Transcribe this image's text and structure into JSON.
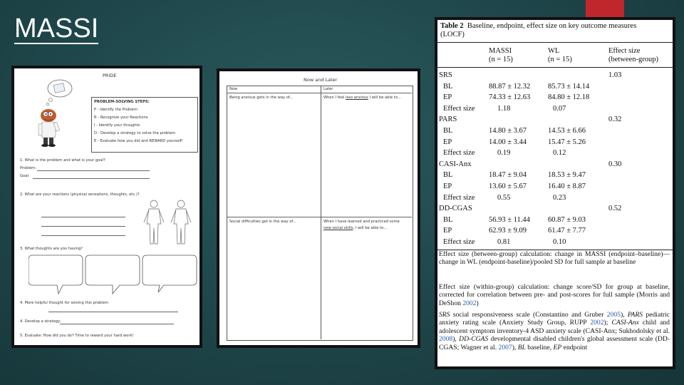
{
  "slide": {
    "title": "MASSI",
    "accent_color": "#c0272d",
    "background_color": "#1e4549"
  },
  "pride_worksheet": {
    "heading": "PRIDE",
    "steps_title": "PROBLEM-SOLVING STEPS:",
    "steps": [
      "P - Identify the Problem",
      "R - Recognize your Reactions",
      "I - Identify your thoughts",
      "D - Develop a strategy to solve the problem",
      "E - Evaluate how you did and REWARD yourself!"
    ],
    "q1": "1. What is the problem and what is your goal?",
    "problem_label": "Problem:",
    "goal_label": "Goal:",
    "q2": "2. What are your reactions (physical sensations, thoughts, etc.)?",
    "q3": "3. What thoughts are you having?",
    "q4": "4. More helpful thought for solving this problem",
    "q5": "4. Develop a strategy:",
    "q6": "5. Evaluate: How did you do? Time to reward your hard work!"
  },
  "now_later_worksheet": {
    "heading": "Now and Later",
    "col_now": "Now",
    "col_later": "Later",
    "row1_now": "Being anxious gets in the way of...",
    "row1_later_pre": "When I feel ",
    "row1_later_em": "less anxious",
    "row1_later_post": " I will be able to...",
    "row2_now": "Social difficulties get in the way of...",
    "row2_later_pre": "When I have learned and practiced some ",
    "row2_later_em": "new social skills",
    "row2_later_post": ", I will be able to..."
  },
  "table": {
    "caption_bold": "Table 2",
    "caption_text": "Baseline, endpoint, effect size on key outcome measures",
    "caption_line2": "(LOCF)",
    "col_massi": "MASSI",
    "col_massi_n": "(n = 15)",
    "col_wl": "WL",
    "col_wl_n": "(n = 15)",
    "col_effect": "Effect size",
    "col_effect_sub": "(between-group)",
    "groups": [
      {
        "name": "SRS",
        "effect": "1.03",
        "rows": [
          {
            "label": "BL",
            "massi": "88.87 ± 12.32",
            "wl": "85.73 ± 14.14"
          },
          {
            "label": "EP",
            "massi": "74.33 ± 12.63",
            "wl": "84.80 ± 12.18"
          },
          {
            "label": "Effect size",
            "massi": "1.18",
            "wl": "0.07"
          }
        ]
      },
      {
        "name": "PARS",
        "effect": "0.32",
        "rows": [
          {
            "label": "BL",
            "massi": "14.80 ± 3.67",
            "wl": "14.53 ± 6.66"
          },
          {
            "label": "EP",
            "massi": "14.00 ± 3.44",
            "wl": "15.47 ± 5.26"
          },
          {
            "label": "Effect size",
            "massi": "0.19",
            "wl": "0.12"
          }
        ]
      },
      {
        "name": "CASI-Anx",
        "effect": "0.30",
        "rows": [
          {
            "label": "BL",
            "massi": "18.47 ± 9.04",
            "wl": "18.53 ± 9.47"
          },
          {
            "label": "EP",
            "massi": "13.60 ± 5.67",
            "wl": "16.40 ± 8.87"
          },
          {
            "label": "Effect size",
            "massi": "0.55",
            "wl": "0.23"
          }
        ]
      },
      {
        "name": "DD-CGAS",
        "effect": "0.52",
        "rows": [
          {
            "label": "BL",
            "massi": "56.93 ± 11.44",
            "wl": "60.87 ± 9.03"
          },
          {
            "label": "EP",
            "massi": "62.93 ± 9.09",
            "wl": "61.47 ± 7.77"
          },
          {
            "label": "Effect size",
            "massi": "0.81",
            "wl": "0.10"
          }
        ]
      }
    ],
    "note1": "Effect size (between-group) calculation: change in MASSI (endpoint–baseline)—change in WL (endpoint-baseline)/pooled SD for full sample at baseline",
    "note2": "Effect size (within-group) calculation: change score/SD for group at baseline, corrected for correlation between pre- and post-scores for full sample (Morris and DeShon 2002)",
    "note3": "SRS social responsiveness scale (Constantino and Gruber 2005), PARS pediatric anxiety rating scale (Anxiety Study Group, RUPP 2002); CASI-Anx child and adolescent symptom inventory-4 ASD anxiety scale (CASI-Anx; Sukhodolsky et al. 2008), DD-CGAS developmental disabled children's global assessment scale (DD-CGAS; Wagner et al. 2007), BL baseline, EP endpoint"
  }
}
